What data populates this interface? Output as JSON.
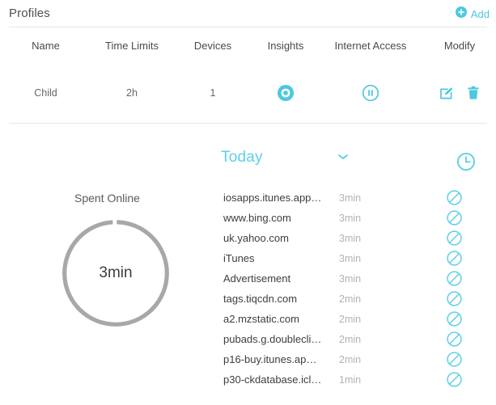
{
  "header": {
    "title": "Profiles",
    "add_label": "Add",
    "add_icon": "plus-circle-icon"
  },
  "colors": {
    "accent": "#4dc8e0",
    "accent_light": "#5ed0e6",
    "text": "#444444",
    "muted": "#b2b2b2",
    "divider": "#e6e6e6",
    "ring": "#a8a8a8"
  },
  "table": {
    "columns": [
      "Name",
      "Time Limits",
      "Devices",
      "Insights",
      "Internet Access",
      "Modify"
    ],
    "rows": [
      {
        "name": "Child",
        "time_limits": "2h",
        "devices": "1",
        "insights_icon": "eye-icon",
        "internet_access_icon": "pause-circle-icon",
        "modify_icons": [
          "edit-icon",
          "delete-icon"
        ]
      }
    ]
  },
  "insights": {
    "period_label": "Today",
    "period_dropdown_icon": "chevron-down-icon",
    "history_icon": "clock-icon",
    "spent_online_label": "Spent Online",
    "spent_online_value": "3min",
    "sites": [
      {
        "name": "iosapps.itunes.app…",
        "time": "3min",
        "block_icon": "block-icon"
      },
      {
        "name": "www.bing.com",
        "time": "3min",
        "block_icon": "block-icon"
      },
      {
        "name": "uk.yahoo.com",
        "time": "3min",
        "block_icon": "block-icon"
      },
      {
        "name": "iTunes",
        "time": "3min",
        "block_icon": "block-icon"
      },
      {
        "name": "Advertisement",
        "time": "3min",
        "block_icon": "block-icon"
      },
      {
        "name": "tags.tiqcdn.com",
        "time": "2min",
        "block_icon": "block-icon"
      },
      {
        "name": "a2.mzstatic.com",
        "time": "2min",
        "block_icon": "block-icon"
      },
      {
        "name": "pubads.g.doublecli…",
        "time": "2min",
        "block_icon": "block-icon"
      },
      {
        "name": "p16-buy.itunes.ap…",
        "time": "2min",
        "block_icon": "block-icon"
      },
      {
        "name": "p30-ckdatabase.icl…",
        "time": "1min",
        "block_icon": "block-icon"
      }
    ]
  },
  "chart_data": {
    "type": "pie",
    "title": "Spent Online",
    "center_label": "3min",
    "categories": [
      "Spent Online"
    ],
    "values": [
      100
    ],
    "colors": [
      "#a8a8a8"
    ],
    "donut": true,
    "legend": "none"
  }
}
